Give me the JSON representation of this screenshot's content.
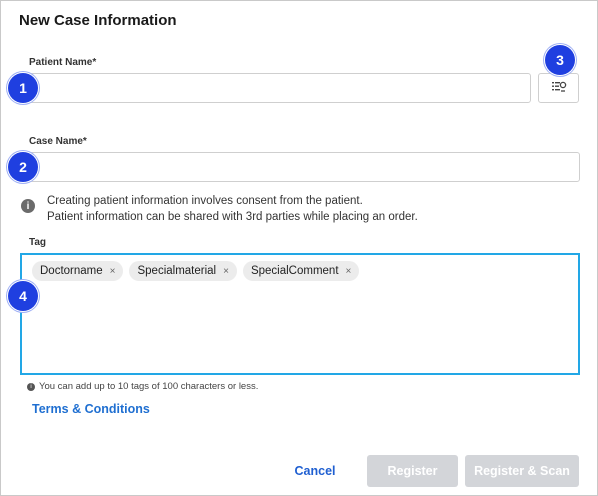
{
  "dialog": {
    "title": "New Case Information",
    "patient_name": {
      "label": "Patient Name*",
      "value": "",
      "placeholder": ""
    },
    "case_name": {
      "label": "Case Name*",
      "value": "",
      "placeholder": ""
    },
    "info": {
      "line1": "Creating patient information involves consent from the patient.",
      "line2": "Patient information can be shared with 3rd parties while placing an order."
    },
    "tag": {
      "label": "Tag",
      "tags": [
        "Doctorname",
        "Specialmaterial",
        "SpecialComment"
      ],
      "remove_glyph": "×",
      "hint": "You can add up to 10 tags of 100 characters or less."
    },
    "terms_link": "Terms & Conditions",
    "buttons": {
      "cancel": "Cancel",
      "register": "Register",
      "register_scan": "Register & Scan"
    },
    "markers": [
      "1",
      "2",
      "3",
      "4"
    ],
    "icons": {
      "patient_search": "patient-list-search-icon",
      "info": "info-icon"
    },
    "colors": {
      "accent": "#1f5fd1",
      "marker": "#1f3fe0",
      "focus_border": "#22a7e6",
      "disabled_button": "#d3d5d9"
    }
  }
}
